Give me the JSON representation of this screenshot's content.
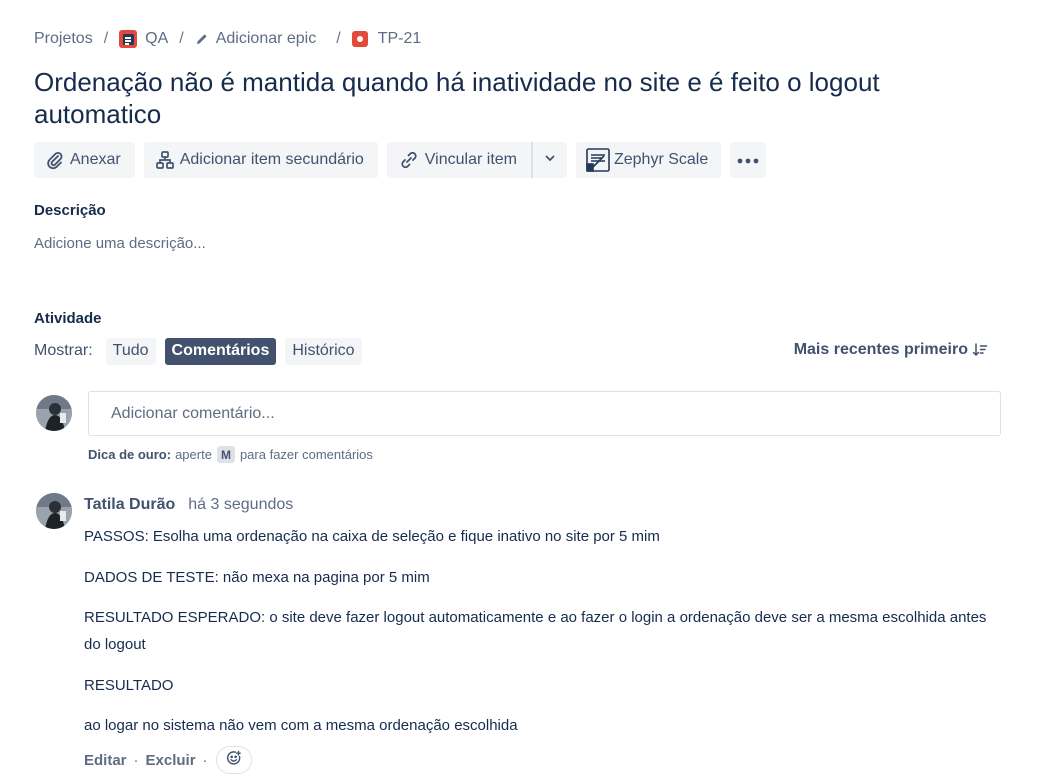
{
  "breadcrumb": {
    "projects": "Projetos",
    "project": "QA",
    "epic": "Adicionar epic",
    "issue_key": "TP-21"
  },
  "issue": {
    "title": "Ordenação não é mantida quando há inatividade no site e é feito o logout automatico"
  },
  "toolbar": {
    "attach": "Anexar",
    "add_child": "Adicionar item secundário",
    "link_item": "Vincular item",
    "zephyr": "Zephyr Scale"
  },
  "description": {
    "label": "Descrição",
    "placeholder": "Adicione uma descrição..."
  },
  "activity": {
    "label": "Atividade",
    "show_label": "Mostrar:",
    "filters": [
      "Tudo",
      "Comentários",
      "Histórico"
    ],
    "active_filter": "Comentários",
    "sort_label": "Mais recentes primeiro"
  },
  "comment_box": {
    "placeholder": "Adicionar comentário...",
    "tip_bold": "Dica de ouro:",
    "tip_pre": "aperte",
    "tip_key": "M",
    "tip_post": "para fazer comentários"
  },
  "comment": {
    "author": "Tatila Durão",
    "time": "há 3 segundos",
    "paragraphs": [
      "PASSOS: Esolha uma ordenação na caixa de seleção e fique inativo no site por 5 mim",
      "DADOS DE TESTE: não mexa na pagina por 5 mim",
      "RESULTADO ESPERADO: o site deve fazer logout automaticamente e ao fazer o login a ordenação deve ser a mesma escolhida antes do logout",
      "RESULTADO",
      "ao logar no sistema não vem com a mesma ordenação escolhida"
    ],
    "edit": "Editar",
    "delete": "Excluir"
  },
  "colors": {
    "text": "#172b4d",
    "subtle": "#5e6c84",
    "button_bg": "#f4f5f7",
    "active_filter_bg": "#42526e",
    "project_icon": "#e2483d",
    "bug_icon": "#e5493a"
  }
}
